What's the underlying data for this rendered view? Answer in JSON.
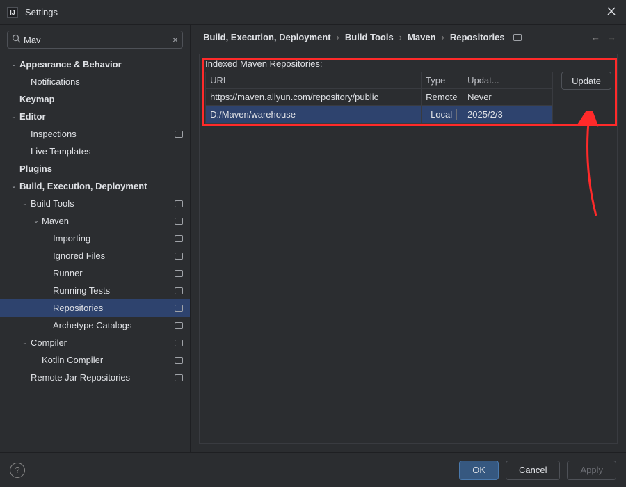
{
  "window": {
    "title": "Settings"
  },
  "search": {
    "value": "Mav"
  },
  "sidebar": [
    {
      "label": "Appearance & Behavior",
      "bold": true,
      "indent": 0,
      "chev": "down",
      "tag": false
    },
    {
      "label": "Notifications",
      "bold": false,
      "indent": 1,
      "chev": "",
      "tag": false
    },
    {
      "label": "Keymap",
      "bold": true,
      "indent": 0,
      "chev": "",
      "tag": false
    },
    {
      "label": "Editor",
      "bold": true,
      "indent": 0,
      "chev": "down",
      "tag": false
    },
    {
      "label": "Inspections",
      "bold": false,
      "indent": 1,
      "chev": "",
      "tag": true
    },
    {
      "label": "Live Templates",
      "bold": false,
      "indent": 1,
      "chev": "",
      "tag": false
    },
    {
      "label": "Plugins",
      "bold": true,
      "indent": 0,
      "chev": "",
      "tag": false
    },
    {
      "label": "Build, Execution, Deployment",
      "bold": true,
      "indent": 0,
      "chev": "down",
      "tag": false
    },
    {
      "label": "Build Tools",
      "bold": false,
      "indent": 1,
      "chev": "down",
      "tag": true
    },
    {
      "label": "Maven",
      "bold": false,
      "indent": 2,
      "chev": "down",
      "tag": true
    },
    {
      "label": "Importing",
      "bold": false,
      "indent": 3,
      "chev": "",
      "tag": true
    },
    {
      "label": "Ignored Files",
      "bold": false,
      "indent": 3,
      "chev": "",
      "tag": true
    },
    {
      "label": "Runner",
      "bold": false,
      "indent": 3,
      "chev": "",
      "tag": true
    },
    {
      "label": "Running Tests",
      "bold": false,
      "indent": 3,
      "chev": "",
      "tag": true
    },
    {
      "label": "Repositories",
      "bold": false,
      "indent": 3,
      "chev": "",
      "tag": true,
      "selected": true
    },
    {
      "label": "Archetype Catalogs",
      "bold": false,
      "indent": 3,
      "chev": "",
      "tag": true
    },
    {
      "label": "Compiler",
      "bold": false,
      "indent": 1,
      "chev": "down",
      "tag": true
    },
    {
      "label": "Kotlin Compiler",
      "bold": false,
      "indent": 2,
      "chev": "",
      "tag": true
    },
    {
      "label": "Remote Jar Repositories",
      "bold": false,
      "indent": 1,
      "chev": "",
      "tag": true
    }
  ],
  "breadcrumb": {
    "p0": "Build, Execution, Deployment",
    "p1": "Build Tools",
    "p2": "Maven",
    "p3": "Repositories"
  },
  "section": {
    "label": "Indexed Maven Repositories:"
  },
  "table": {
    "headers": {
      "url": "URL",
      "type": "Type",
      "updated": "Updat..."
    },
    "rows": [
      {
        "url": "https://maven.aliyun.com/repository/public",
        "type": "Remote",
        "updated": "Never",
        "selected": false
      },
      {
        "url": "D:/Maven/warehouse",
        "type": "Local",
        "updated": "2025/2/3",
        "selected": true
      }
    ]
  },
  "buttons": {
    "update": "Update",
    "ok": "OK",
    "cancel": "Cancel",
    "apply": "Apply"
  }
}
